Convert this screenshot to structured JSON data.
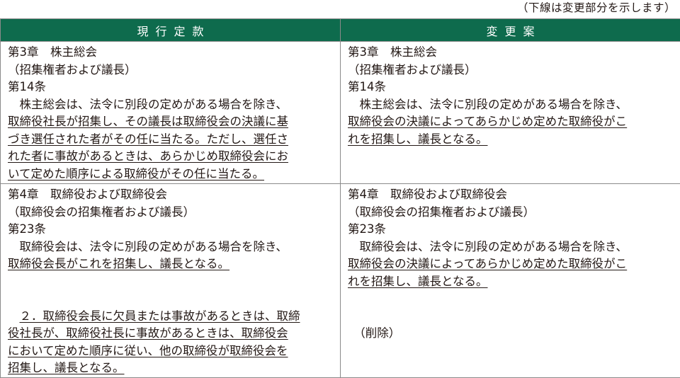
{
  "note": "（下線は変更部分を示します）",
  "headers": {
    "current": "現行定款",
    "proposed": "変更案"
  },
  "current": {
    "art14": {
      "chapter": "第3章　株主総会",
      "caption": "（招集権者および議長）",
      "article": "第14条",
      "l1": "株主総会は、法令に別段の定めがある場合を除き、",
      "l2": "取締役社長が招集し、その議長は取締役会の決議に基",
      "l3": "づき選任された者がその任に当たる。ただし、選任さ",
      "l4": "れた者に事故があるときは、あらかじめ取締役会にお",
      "l5": "いて定めた順序による取締役がその任に当たる。"
    },
    "art23": {
      "chapter": "第4章　取締役および取締役会",
      "caption": "（取締役会の招集権者および議長）",
      "article": "第23条",
      "l1": "取締役会は、法令に別段の定めがある場合を除き、",
      "l2": "取締役会長がこれを招集し、議長となる。",
      "p2l1": "２．取締役会長に欠員または事故があるときは、取締",
      "p2l2": "役社長が、取締役社長に事故があるときは、取締役会",
      "p2l3": "において定めた順序に従い、他の取締役が取締役会を",
      "p2l4": "招集し、議長となる。"
    }
  },
  "proposed": {
    "art14": {
      "chapter": "第3章　株主総会",
      "caption": "（招集権者および議長）",
      "article": "第14条",
      "l1": "株主総会は、法令に別段の定めがある場合を除き、",
      "l2": "取締役会の決議によってあらかじめ定めた取締役がこ",
      "l3": "れを招集し、議長となる。"
    },
    "art23": {
      "chapter": "第4章　取締役および取締役会",
      "caption": "（取締役会の招集権者および議長）",
      "article": "第23条",
      "l1": "取締役会は、法令に別段の定めがある場合を除き、",
      "l2": "取締役会の決議によってあらかじめ定めた取締役がこ",
      "l3": "れを招集し、議長となる。",
      "deleted": "（削除）"
    }
  }
}
